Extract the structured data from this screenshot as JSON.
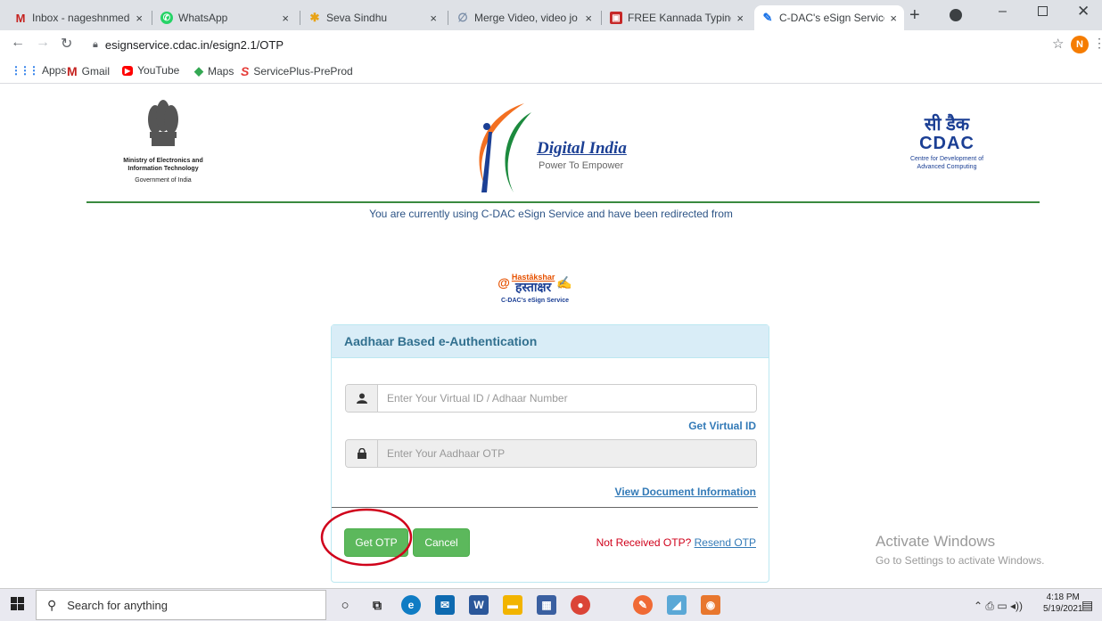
{
  "browser": {
    "tabs": [
      {
        "label": "Inbox - nageshnmedc",
        "icon": "gmail-icon",
        "color": "#c5221f",
        "glyph": "M"
      },
      {
        "label": "WhatsApp",
        "icon": "whatsapp-icon",
        "color": "#25d366",
        "glyph": "✆"
      },
      {
        "label": "Seva Sindhu",
        "icon": "seva-sindhu-icon",
        "color": "#e8a317",
        "glyph": "✱"
      },
      {
        "label": "Merge Video, video jo",
        "icon": "merge-video-icon",
        "color": "#7b8ea8",
        "glyph": "∅"
      },
      {
        "label": "FREE Kannada Typing",
        "icon": "kannada-typing-icon",
        "color": "#c62828",
        "glyph": "▣"
      },
      {
        "label": "C-DAC's eSign Service",
        "icon": "esign-icon",
        "color": "#1a73e8",
        "glyph": "✎"
      }
    ],
    "tab_close": "×",
    "new_tab": "+",
    "url": "esignservice.cdac.in/esign2.1/OTP",
    "profile_initial": "N",
    "bookmarks": [
      {
        "label": "Apps",
        "icon": "apps-grid-icon",
        "color": "#1a73e8",
        "glyph": "⋮⋮"
      },
      {
        "label": "Gmail",
        "icon": "gmail-icon",
        "color": "#c5221f",
        "glyph": "M"
      },
      {
        "label": "YouTube",
        "icon": "youtube-icon",
        "color": "#ff0000",
        "glyph": "▶"
      },
      {
        "label": "Maps",
        "icon": "maps-icon",
        "color": "#34a853",
        "glyph": "◆"
      },
      {
        "label": "ServicePlus-PreProd",
        "icon": "serviceplus-icon",
        "color": "#e53935",
        "glyph": "S"
      }
    ]
  },
  "header": {
    "meity_lines": [
      "Ministry of Electronics and",
      "Information Technology",
      "Government of India"
    ],
    "digital_india_title": "Digital India",
    "digital_india_tagline": "Power To Empower",
    "cdac_hindi": "सी डैक",
    "cdac_logo": "CDAC",
    "cdac_lines": [
      "Centre for Development of",
      "Advanced Computing"
    ]
  },
  "redirect_notice": "You are currently using C-DAC eSign Service and have been redirected from",
  "hastakshar": {
    "top": "Hastākshar",
    "hindi": "हस्ताक्षर",
    "caption": "C-DAC's eSign Service"
  },
  "form": {
    "title": "Aadhaar Based e-Authentication",
    "vid_placeholder": "Enter Your Virtual ID / Adhaar Number",
    "get_virtual_id": "Get Virtual ID",
    "otp_placeholder": "Enter Your Aadhaar OTP",
    "view_document": "View Document Information",
    "get_otp": "Get OTP",
    "cancel": "Cancel",
    "not_received": "Not Received OTP?",
    "resend_otp": "Resend OTP"
  },
  "watermark": {
    "title": "Activate Windows",
    "subtitle": "Go to Settings to activate Windows."
  },
  "taskbar": {
    "search_placeholder": "Search for anything",
    "time": "4:18 PM",
    "date": "5/19/2021"
  },
  "colors": {
    "accent_green": "#5cb85c",
    "panel_blue": "#d9edf7",
    "link_blue": "#337ab7",
    "annotation_red": "#d0021b"
  }
}
